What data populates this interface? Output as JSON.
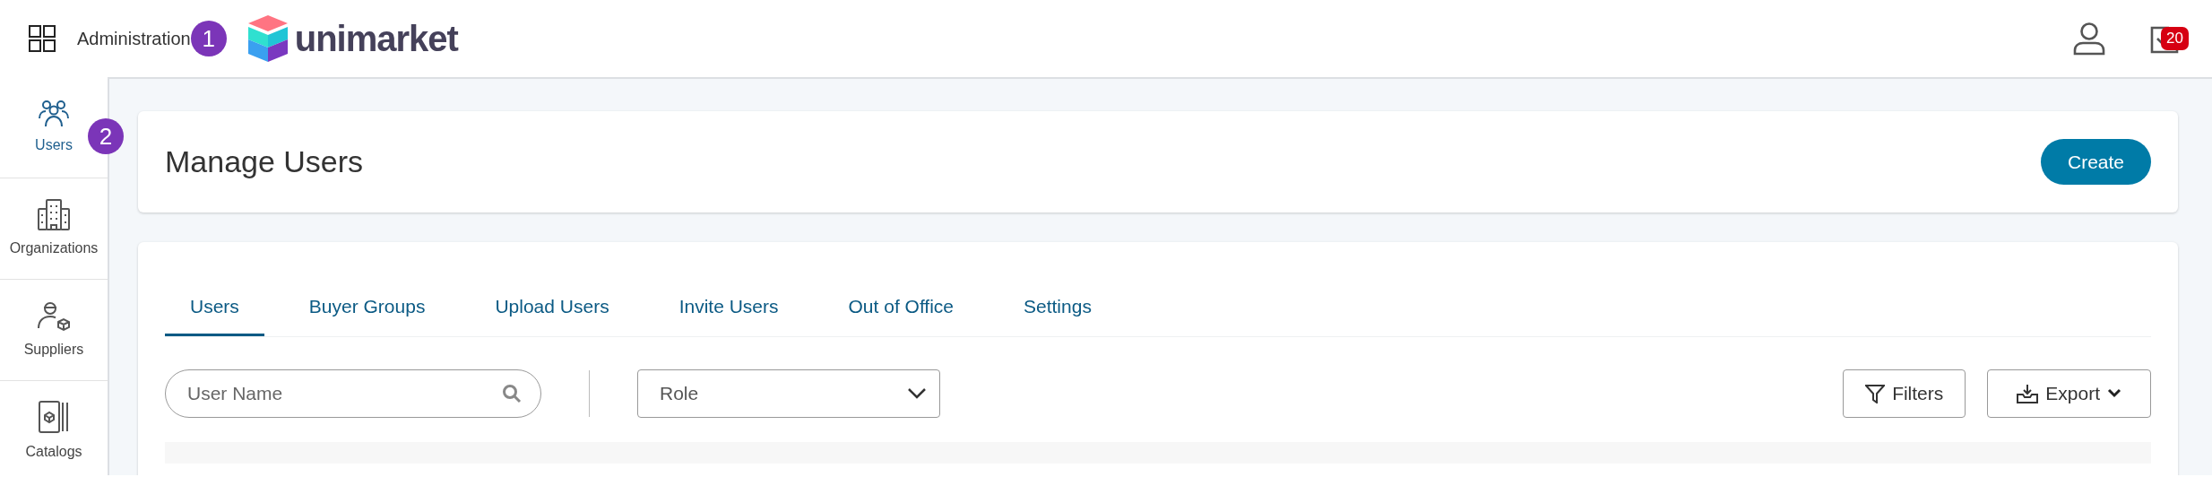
{
  "header": {
    "app_label": "Administration",
    "step_marker": "1",
    "logo_text": "unimarket",
    "task_badge": "20"
  },
  "sidebar": {
    "step_marker": "2",
    "items": [
      {
        "kind": "users",
        "label": "Users",
        "selected": true
      },
      {
        "kind": "organizations",
        "label": "Organizations",
        "selected": false
      },
      {
        "kind": "suppliers",
        "label": "Suppliers",
        "selected": false
      },
      {
        "kind": "catalogs",
        "label": "Catalogs",
        "selected": false
      }
    ]
  },
  "page": {
    "title": "Manage Users",
    "create_button": "Create"
  },
  "tabs": [
    {
      "label": "Users",
      "selected": true
    },
    {
      "label": "Buyer Groups",
      "selected": false
    },
    {
      "label": "Upload Users",
      "selected": false
    },
    {
      "label": "Invite Users",
      "selected": false
    },
    {
      "label": "Out of Office",
      "selected": false
    },
    {
      "label": "Settings",
      "selected": false
    }
  ],
  "filters": {
    "search": {
      "placeholder": "User Name"
    },
    "role": {
      "value": "Role"
    },
    "filters_button": "Filters",
    "export_button": "Export"
  }
}
